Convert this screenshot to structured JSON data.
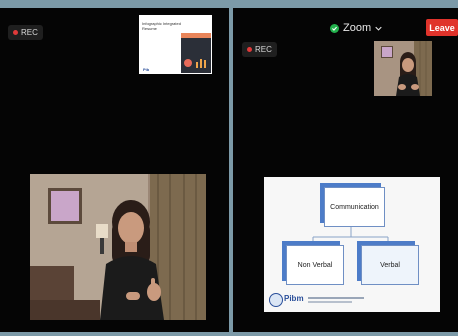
{
  "left_panel": {
    "rec_label": "REC",
    "thumbnail": {
      "title": "Infographic Integrated Resume",
      "logo_text": "Pib"
    }
  },
  "right_panel": {
    "rec_label": "REC",
    "zoom_label": "Zoom",
    "leave_label": "Leave",
    "slide": {
      "top_node": "Communication",
      "left_node": "Non Verbal",
      "right_node": "Verbal",
      "logo_text": "Pibm"
    }
  },
  "colors": {
    "leave_button": "#e0332b",
    "rec_dot": "#e03a3a",
    "secure_green": "#22b14c",
    "slide_box_accent": "#4d7cc8"
  },
  "icons": [
    "rec-dot-icon",
    "shield-check-icon",
    "chevron-down-icon"
  ]
}
